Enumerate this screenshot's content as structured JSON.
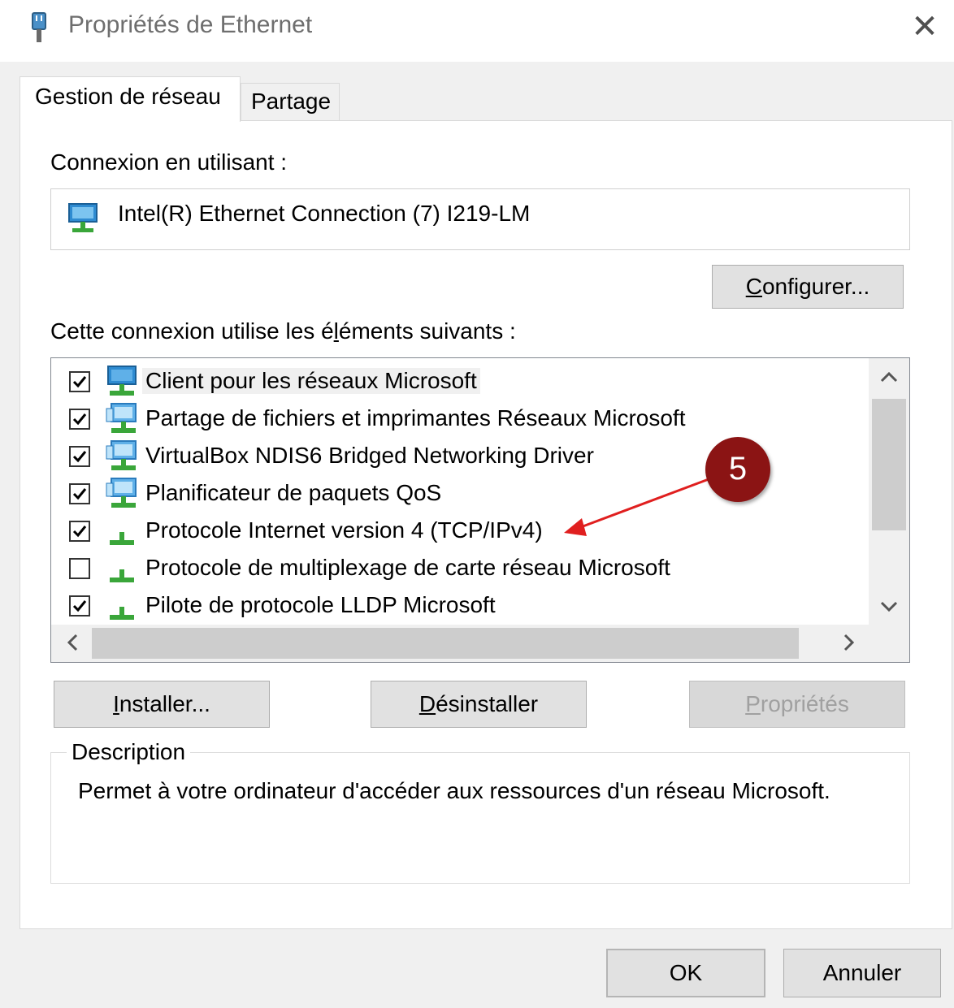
{
  "window": {
    "title": "Propriétés de Ethernet",
    "close_label": "✕"
  },
  "tabs": [
    {
      "label": "Gestion de réseau",
      "active": true
    },
    {
      "label": "Partage",
      "active": false
    }
  ],
  "connection": {
    "label": "Connexion en utilisant :",
    "adapter_name": "Intel(R) Ethernet Connection (7) I219-LM",
    "configure_button_pre": "",
    "configure_button_accel": "C",
    "configure_button_post": "onfigurer..."
  },
  "components": {
    "label_pre": "Cette connexion utilise les é",
    "label_accel": "l",
    "label_post": "éments suivants :",
    "items": [
      {
        "label": "Client pour les réseaux Microsoft",
        "checked": true,
        "icon": "network-client-icon"
      },
      {
        "label": "Partage de fichiers et imprimantes Réseaux Microsoft",
        "checked": true,
        "icon": "network-service-icon"
      },
      {
        "label": "VirtualBox NDIS6 Bridged Networking Driver",
        "checked": true,
        "icon": "network-service-icon"
      },
      {
        "label": "Planificateur de paquets QoS",
        "checked": true,
        "icon": "network-service-icon"
      },
      {
        "label": "Protocole Internet version 4 (TCP/IPv4)",
        "checked": true,
        "icon": "network-protocol-icon"
      },
      {
        "label": "Protocole de multiplexage de carte réseau Microsoft",
        "checked": false,
        "icon": "network-protocol-icon"
      },
      {
        "label": "Pilote de protocole LLDP Microsoft",
        "checked": true,
        "icon": "network-protocol-icon"
      }
    ]
  },
  "actions": {
    "install_accel": "I",
    "install_rest": "nstaller...",
    "uninstall_accel": "D",
    "uninstall_rest": "ésinstaller",
    "properties_accel": "P",
    "properties_rest": "ropriétés"
  },
  "description": {
    "legend": "Description",
    "text": "Permet à votre ordinateur d'accéder aux ressources d'un réseau Microsoft."
  },
  "annotation": {
    "step_number": "5",
    "color": "#8b1414"
  },
  "footer": {
    "ok_label": "OK",
    "cancel_label": "Annuler"
  },
  "scroll": {
    "up": "^",
    "down": "v",
    "left": "<",
    "right": ">"
  }
}
